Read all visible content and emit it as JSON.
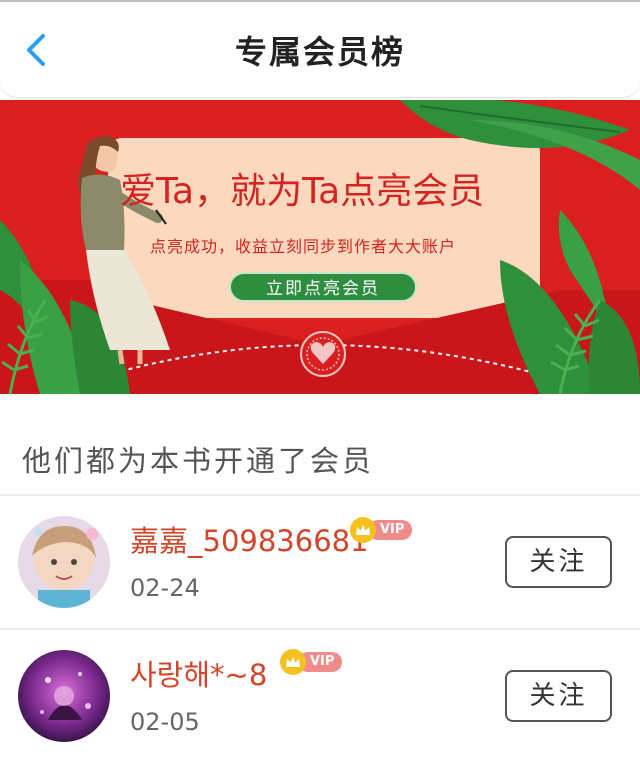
{
  "header": {
    "title": "专属会员榜",
    "back_icon": "chevron-left-icon",
    "accent_color": "#2a9df4"
  },
  "banner": {
    "headline": "爱Ta，就为Ta点亮会员",
    "subtitle": "点亮成功，收益立刻同步到作者大大账户",
    "cta_label": "立即点亮会员",
    "background_color": "#d9201f",
    "cta_color": "#2e8d3f"
  },
  "section": {
    "heading": "他们都为本书开通了会员"
  },
  "members": [
    {
      "name": "嘉嘉_509836681",
      "vip_label": "VIP",
      "date": "02-24",
      "follow_label": "关注"
    },
    {
      "name": "사랑해*~8",
      "vip_label": "VIP",
      "date": "02-05",
      "follow_label": "关注"
    }
  ]
}
